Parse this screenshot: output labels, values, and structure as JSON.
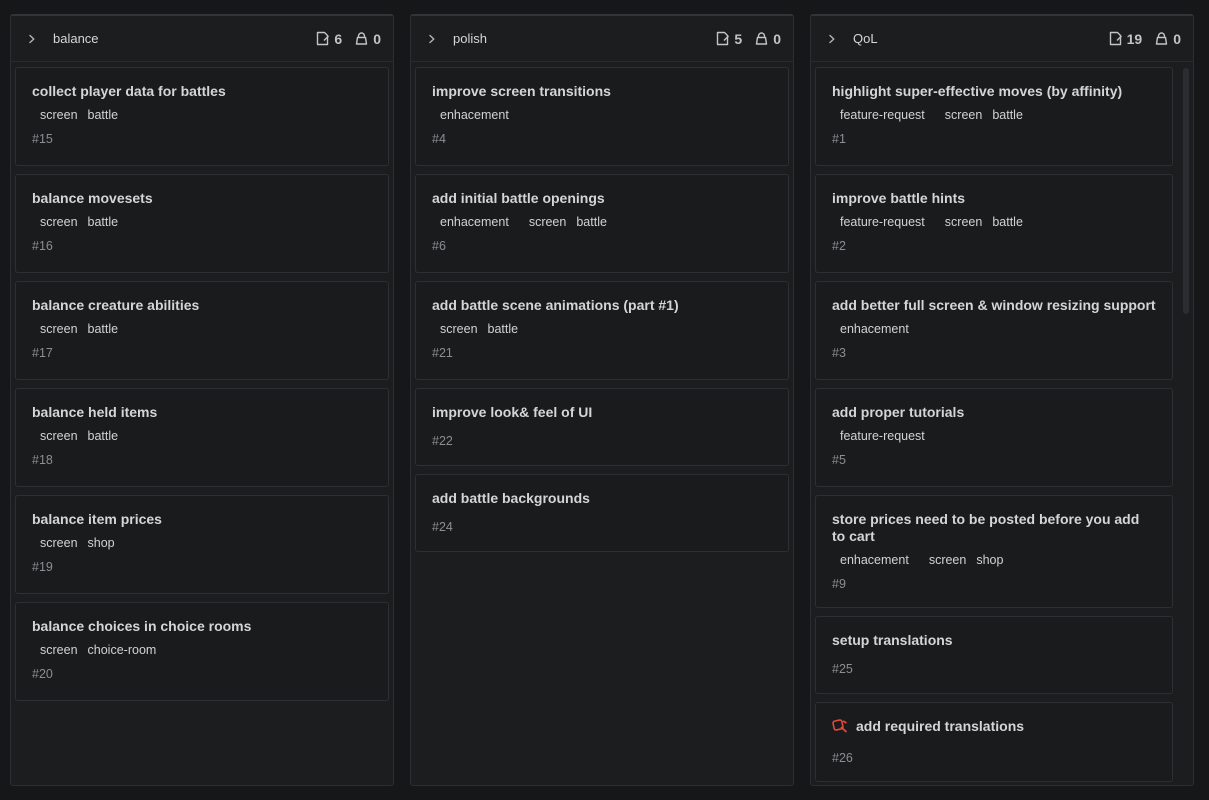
{
  "columns": [
    {
      "name": "balance",
      "issue_count": "6",
      "lock_count": "0",
      "cards": [
        {
          "title": "collect player data for battles",
          "label_groups": [
            [
              "screen",
              "battle"
            ]
          ],
          "number": "#15"
        },
        {
          "title": "balance movesets",
          "label_groups": [
            [
              "screen",
              "battle"
            ]
          ],
          "number": "#16"
        },
        {
          "title": "balance creature abilities",
          "label_groups": [
            [
              "screen",
              "battle"
            ]
          ],
          "number": "#17"
        },
        {
          "title": "balance held items",
          "label_groups": [
            [
              "screen",
              "battle"
            ]
          ],
          "number": "#18"
        },
        {
          "title": "balance item prices",
          "label_groups": [
            [
              "screen",
              "shop"
            ]
          ],
          "number": "#19"
        },
        {
          "title": "balance choices in choice rooms",
          "label_groups": [
            [
              "screen",
              "choice-room"
            ]
          ],
          "number": "#20"
        }
      ]
    },
    {
      "name": "polish",
      "issue_count": "5",
      "lock_count": "0",
      "cards": [
        {
          "title": "improve screen transitions",
          "label_groups": [
            [
              "enhacement"
            ]
          ],
          "number": "#4"
        },
        {
          "title": "add initial battle openings",
          "label_groups": [
            [
              "enhacement"
            ],
            [
              "screen",
              "battle"
            ]
          ],
          "number": "#6"
        },
        {
          "title": "add battle scene animations (part #1)",
          "label_groups": [
            [
              "screen",
              "battle"
            ]
          ],
          "number": "#21"
        },
        {
          "title": "improve look& feel of UI",
          "label_groups": [],
          "number": "#22"
        },
        {
          "title": "add battle backgrounds",
          "label_groups": [],
          "number": "#24"
        }
      ]
    },
    {
      "name": "QoL",
      "issue_count": "19",
      "lock_count": "0",
      "cards": [
        {
          "title": "highlight super-effective moves (by affinity)",
          "label_groups": [
            [
              "feature-request"
            ],
            [
              "screen",
              "battle"
            ]
          ],
          "number": "#1"
        },
        {
          "title": "improve battle hints",
          "label_groups": [
            [
              "feature-request"
            ],
            [
              "screen",
              "battle"
            ]
          ],
          "number": "#2"
        },
        {
          "title": "add better full screen & window resizing support",
          "label_groups": [
            [
              "enhacement"
            ]
          ],
          "number": "#3"
        },
        {
          "title": "add proper tutorials",
          "label_groups": [
            [
              "feature-request"
            ]
          ],
          "number": "#5"
        },
        {
          "title": "store prices need to be posted before you add to cart",
          "label_groups": [
            [
              "enhacement"
            ],
            [
              "screen",
              "shop"
            ]
          ],
          "number": "#9"
        },
        {
          "title": "setup translations",
          "label_groups": [],
          "number": "#25"
        },
        {
          "title": "add required translations",
          "label_groups": [],
          "number": "#26",
          "icon": "bug-icon"
        }
      ]
    }
  ],
  "colors": {
    "background": "#161718",
    "column": "#1c1d1f",
    "card_border": "#2e2f33",
    "bug_icon": "#e5493a"
  }
}
